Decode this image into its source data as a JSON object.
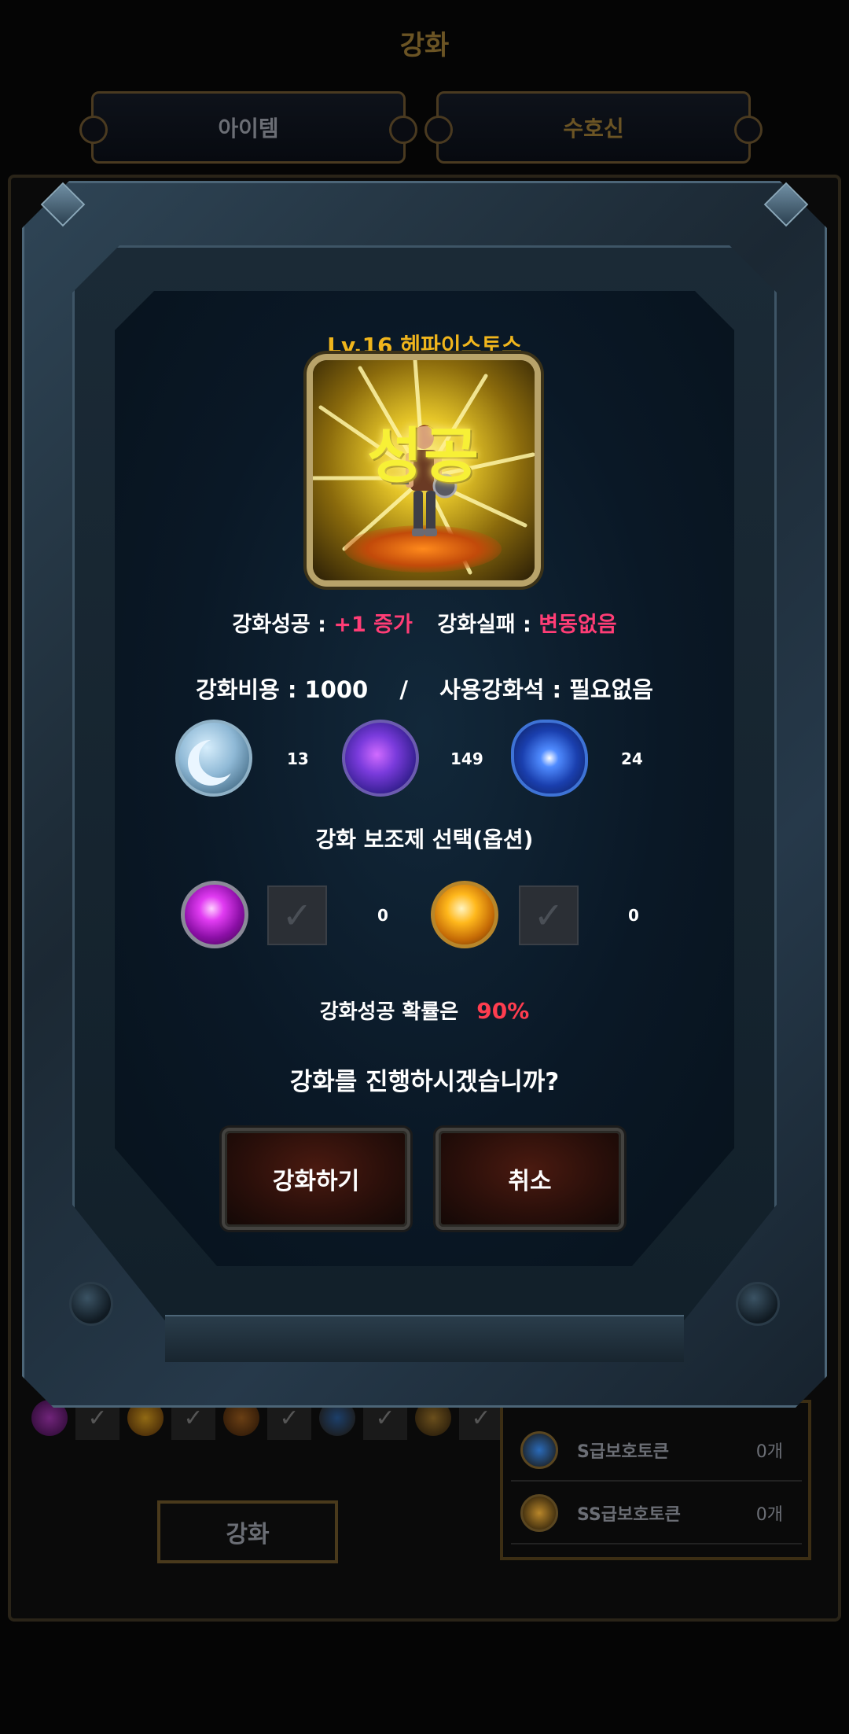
{
  "screen": {
    "title": "강화",
    "tabs": [
      {
        "label": "아이템",
        "active": false
      },
      {
        "label": "수호신",
        "active": true
      }
    ],
    "background": {
      "tokens": [
        {
          "name": "S급보호토큰",
          "count": "0개"
        },
        {
          "name": "SS급보호토큰",
          "count": "0개"
        }
      ],
      "enhance_button": "강화"
    }
  },
  "dialog": {
    "character_title": "Lv.16 헤파이스토스",
    "result_banner": "성공",
    "result": {
      "success_label": "강화성공 :",
      "success_value": "+1 증가",
      "fail_label": "강화실패 :",
      "fail_value": "변동없음"
    },
    "cost": {
      "cost_label": "강화비용 : 1000",
      "separator": "/",
      "stone_label": "사용강화석 : 필요없음"
    },
    "stones": [
      {
        "icon": "moon-stone-icon",
        "count": "13"
      },
      {
        "icon": "galaxy-stone-icon",
        "count": "149"
      },
      {
        "icon": "star-stone-icon",
        "count": "24"
      }
    ],
    "helper_title": "강화 보조제 선택(옵션)",
    "helpers": [
      {
        "icon": "purple-orb-icon",
        "checked": false,
        "count": "0"
      },
      {
        "icon": "gold-orb-icon",
        "checked": false,
        "count": "0"
      }
    ],
    "probability": {
      "label": "강화성공 확률은",
      "value": "90%"
    },
    "question": "강화를 진행하시겠습니까?",
    "buttons": {
      "confirm": "강화하기",
      "cancel": "취소"
    },
    "colors": {
      "accent_gold": "#f0b51c",
      "highlight_pink": "#ff3d76",
      "probability_red": "#ff3d4f",
      "success_yellow": "#f7f036"
    }
  }
}
